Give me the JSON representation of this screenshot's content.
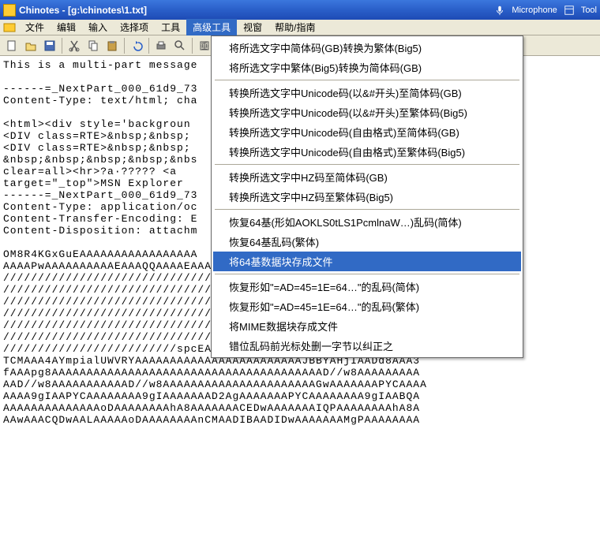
{
  "title": "Chinotes - [g:\\chinotes\\1.txt]",
  "titlebar_right": {
    "microphone": "Microphone",
    "tools": "Tool"
  },
  "menus": {
    "file": "文件",
    "edit": "编辑",
    "input": "输入",
    "options": "选择项",
    "tools": "工具",
    "adv_tools": "高级工具",
    "window": "视窗",
    "help": "帮助/指南"
  },
  "dropdown": {
    "items": [
      "将所选文字中简体码(GB)转换为繁体(Big5)",
      "将所选文字中繁体(Big5)转换为简体码(GB)",
      "---",
      "转换所选文字中Unicode码(以&#开头)至简体码(GB)",
      "转换所选文字中Unicode码(以&#开头)至繁体码(Big5)",
      "转换所选文字中Unicode码(自由格式)至简体码(GB)",
      "转换所选文字中Unicode码(自由格式)至繁体码(Big5)",
      "---",
      "转换所选文字中HZ码至简体码(GB)",
      "转换所选文字中HZ码至繁体码(Big5)",
      "---",
      "恢复64基(形如AOKLS0tLS1PcmlnaW…)乱码(简体)",
      "恢复64基乱码(繁体)",
      "将64基数据块存成文件",
      "---",
      "恢复形如\"=AD=45=1E=64…\"的乱码(简体)",
      "恢复形如\"=AD=45=1E=64…\"的乱码(繁体)",
      "将MIME数据块存成文件",
      "错位乱码前光标处删一字节以纠正之"
    ],
    "highlight_index": 13
  },
  "content": "This is a multi-part message\n\n------=_NextPart_000_61d9_73\nContent-Type: text/html; cha\n\n<html><div style='backgroun\n<DIV class=RTE>&nbsp;&nbsp;\n<DIV class=RTE>&nbsp;&nbsp;\n&nbsp;&nbsp;&nbsp;&nbsp;&nbs\nclear=all><hr>?a·????? <a\ntarget=\"_top\">MSN Explorer \n------=_NextPart_000_61d9_73\nContent-Type: application/oc\nContent-Transfer-Encoding: E\nContent-Disposition: attachm\n\nOM8R4KGxGuEAAAAAAAAAAAAAAAAA\nAAAAPwAAAAAAAAAAEAAAQQAAAAEAAAD+////AAAAAD4AAAD/////////////////\n////////////////////////////////////////////////////////////////\n////////////////////////////////////////////////////////////////\n////////////////////////////////////////////////////////////////\n////////////////////////////////////////////////////////////////\n////////////////////////////////////////////////////////////////\n////////////////////////////////////////////////////////////////\n/////////////////////////spcEANyAJBAAA8BK/AAAAAAAAEAAAAAAAABAAA\nTCMAAA4AYmpialUWVRYAAAAAAAAAAAAAAAAAAAAAAAAJBBYAHjIAADd8AAA3\nfAAApg8AAAAAAAAAAAAAAAAAAAAAAAAAAAAAAAAAAAAAAAD//w8AAAAAAAAA\nAAD//w8AAAAAAAAAAAD//w8AAAAAAAAAAAAAAAAAAAAAAGwAAAAAAAPYCAAAA\nAAAA9gIAAPYCAAAAAAAA9gIAAAAAAAD2AgAAAAAAAPYCAAAAAAAA9gIAABQA\nAAAAAAAAAAAAAAoDAAAAAAAAhA8AAAAAAACEDwAAAAAAAIQPAAAAAAAAhA8A\nAAwAAACQDwAALAAAAAoDAAAAAAAAnCMAADIBAADIDwAAAAAAAMgPAAAAAAAA\n"
}
